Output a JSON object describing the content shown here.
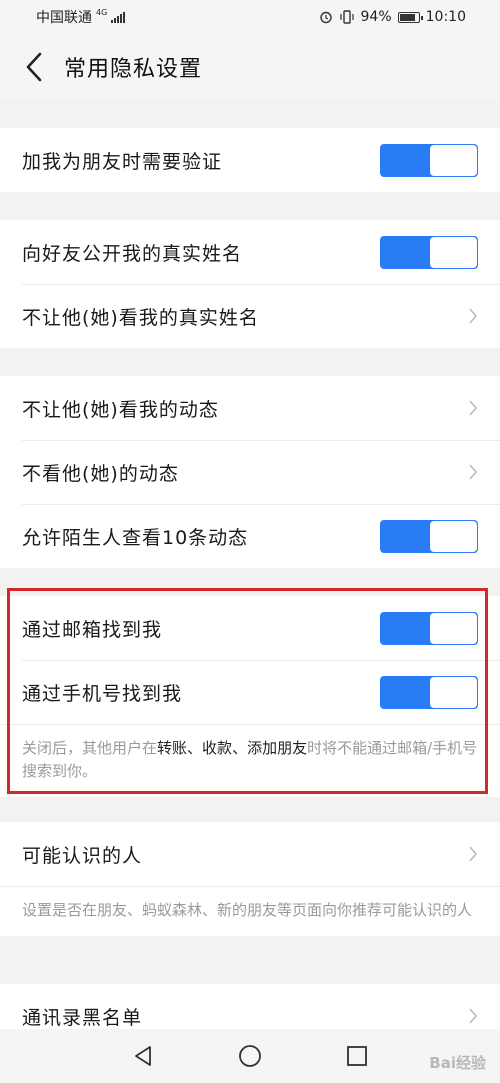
{
  "status_bar": {
    "carrier": "中国联通",
    "network": "4G",
    "battery": "94%",
    "time": "10:10"
  },
  "header": {
    "title": "常用隐私设置",
    "back_icon": "chevron-left-icon"
  },
  "section_verify": {
    "items": [
      {
        "label": "加我为朋友时需要验证",
        "control": "toggle",
        "on": true
      }
    ]
  },
  "section_name": {
    "items": [
      {
        "label": "向好友公开我的真实姓名",
        "control": "toggle",
        "on": true
      },
      {
        "label": "不让他(她)看我的真实姓名",
        "control": "chevron"
      }
    ]
  },
  "section_moments": {
    "items": [
      {
        "label": "不让他(她)看我的动态",
        "control": "chevron"
      },
      {
        "label": "不看他(她)的动态",
        "control": "chevron"
      },
      {
        "label": "允许陌生人查看10条动态",
        "control": "toggle",
        "on": true
      }
    ]
  },
  "section_find": {
    "items": [
      {
        "label": "通过邮箱找到我",
        "control": "toggle",
        "on": true
      },
      {
        "label": "通过手机号找到我",
        "control": "toggle",
        "on": true
      }
    ],
    "note_parts": [
      "关闭后，其他用户在",
      "转账",
      "、",
      "收款",
      "、",
      "添加朋友",
      "时将不能通过邮箱/手机号搜索到你。"
    ]
  },
  "section_people": {
    "items": [
      {
        "label": "可能认识的人",
        "control": "chevron"
      }
    ],
    "note": "设置是否在朋友、蚂蚁森林、新的朋友等页面向你推荐可能认识的人"
  },
  "section_blacklist": {
    "items": [
      {
        "label": "通讯录黑名单",
        "control": "chevron"
      }
    ]
  },
  "system_nav": {
    "icons": [
      "back-triangle-icon",
      "home-circle-icon",
      "recents-square-icon"
    ]
  },
  "watermark": "Bai经验",
  "colors": {
    "toggle_on": "#2a7bf6",
    "highlight_border": "#d7262b",
    "background": "#f2f2f2"
  }
}
